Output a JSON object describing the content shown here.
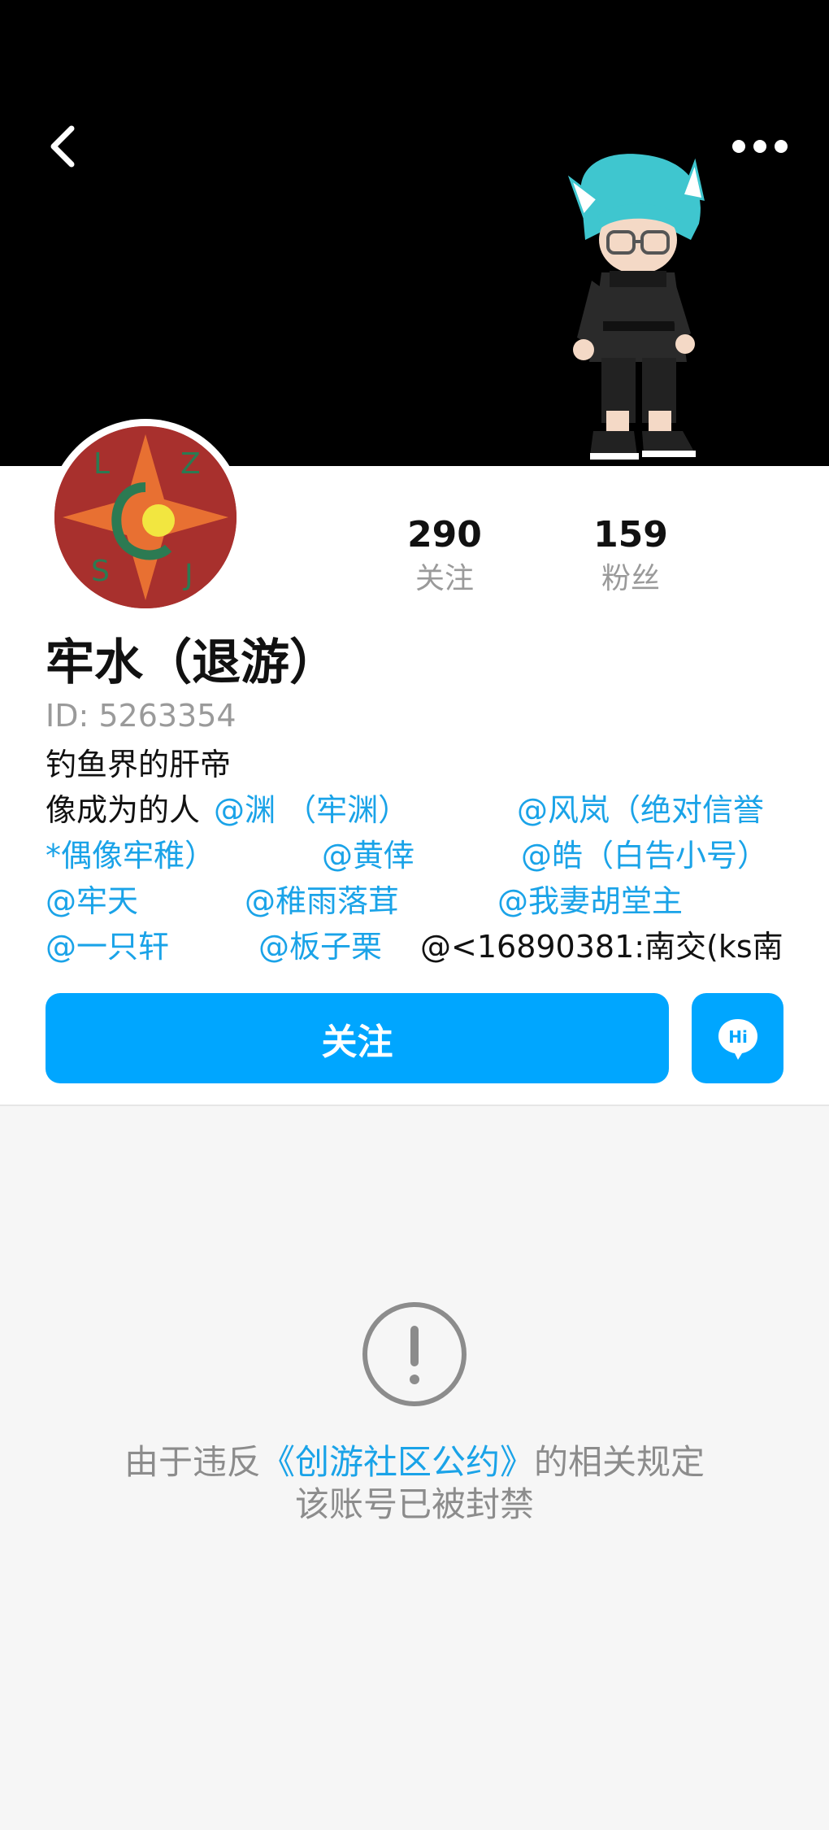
{
  "header": {
    "back_icon": "chevron-left-icon",
    "more_icon": "more-dots-icon"
  },
  "profile": {
    "nickname": "牢水（退游）",
    "id_text": "ID: 5263354",
    "stats": [
      {
        "value": "290",
        "label": "关注"
      },
      {
        "value": "159",
        "label": "粉丝"
      }
    ],
    "avatar_letters": [
      "L",
      "Z",
      "S",
      "J"
    ],
    "bio": {
      "line1": "钓鱼界的肝帝",
      "line2_prefix": "像成为的人",
      "mentions_line2": [
        "@渊 （牢渊）",
        "@风岚（绝对信誉"
      ],
      "mentions_line3": [
        "*偶像牢稚）",
        "@黄倖",
        "@皓（白告小号）"
      ],
      "mentions_line4": [
        "@牢天",
        "@稚雨落茸",
        "@我妻胡堂主"
      ],
      "mentions_line5": [
        "@一只轩",
        "@板子栗"
      ],
      "line5_plain": "@<16890381:南交(ks南"
    }
  },
  "actions": {
    "follow_label": "关注",
    "chat_icon": "hi-chat-icon",
    "chat_label": "Hi"
  },
  "banned": {
    "icon": "exclamation-circle-icon",
    "line1_before": "由于违反",
    "line1_link": "《创游社区公约》",
    "line1_after": "的相关规定",
    "line2": "该账号已被封禁"
  },
  "colors": {
    "accent": "#00a6ff",
    "link": "#1aa3e8",
    "banner_bg": "#000000",
    "muted_text": "#9a9a9a"
  }
}
